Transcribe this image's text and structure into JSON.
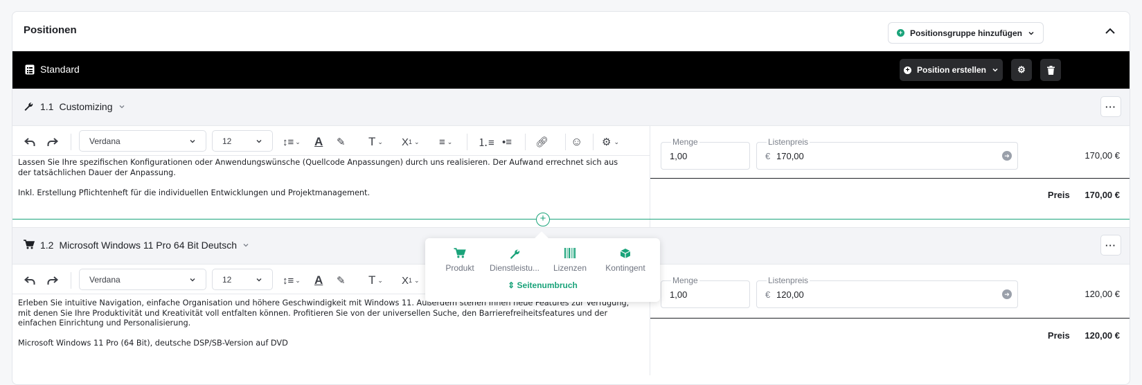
{
  "section": {
    "title": "Positionen",
    "add_group_label": "Positionsgruppe hinzufügen"
  },
  "group": {
    "title": "Standard",
    "create_position_label": "Position erstellen"
  },
  "colors": {
    "accent": "#1aa37a",
    "group_bar": "#000000"
  },
  "positions": [
    {
      "number": "1.1",
      "name": "Customizing",
      "icon": "wrench-icon",
      "font": "Verdana",
      "size": "12",
      "text_lines": [
        "Lassen Sie Ihre spezifischen Konfigurationen oder Anwendungswünsche (Quellcode Anpassungen) durch uns realisieren. Der Aufwand errechnet sich aus",
        "der tatsächlichen Dauer der Anpassung.",
        "",
        "Inkl. Erstellung Pflichtenheft für die individuellen Entwicklungen und Projektmanagement."
      ],
      "menge_label": "Menge",
      "menge": "1,00",
      "listenpreis_label": "Listenpreis",
      "currency": "€",
      "listenpreis": "170,00",
      "line_total": "170,00 €",
      "preis_label": "Preis",
      "preis": "170,00 €"
    },
    {
      "number": "1.2",
      "name": "Microsoft Windows 11 Pro 64 Bit Deutsch",
      "icon": "cart-icon",
      "font": "Verdana",
      "size": "12",
      "text_lines": [
        "Erleben Sie intuitive Navigation, einfache Organisation und höhere Geschwindigkeit mit Windows 11. Außerdem stehen Ihnen neue Features zur Verfügung,",
        "mit denen Sie Ihre Produktivität und Kreativität voll entfalten können. Profitieren Sie von der universellen Suche, den Barrierefreiheitsfeatures und der",
        "einfachen Einrichtung und Personalisierung.",
        "",
        "Microsoft Windows 11 Pro (64 Bit), deutsche DSP/SB-Version auf DVD"
      ],
      "menge_label": "Menge",
      "menge": "1,00",
      "listenpreis_label": "Listenpreis",
      "currency": "€",
      "listenpreis": "120,00",
      "line_total": "120,00 €",
      "preis_label": "Preis",
      "preis": "120,00 €"
    }
  ],
  "add_menu": {
    "items": [
      "Produkt",
      "Dienstleistu...",
      "Lizenzen",
      "Kontingent"
    ],
    "page_break": "Seitenumbruch"
  }
}
